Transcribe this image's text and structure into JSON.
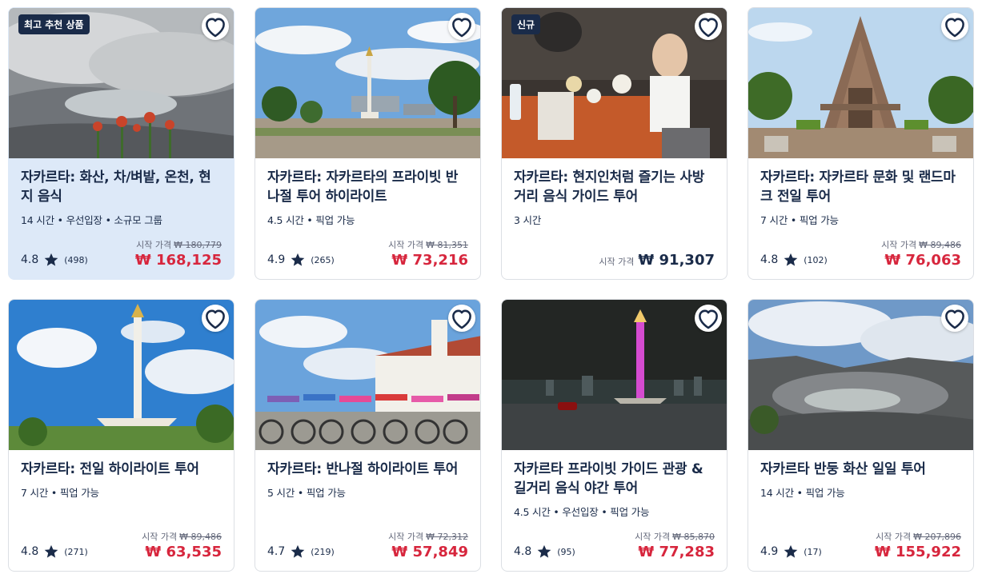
{
  "colors": {
    "accent_price": "#d7263d",
    "text": "#1a2b49",
    "featured_bg": "#dde9f8",
    "badge_bg": "#1a2b49"
  },
  "labels": {
    "price_from": "시작 가격"
  },
  "cards": [
    {
      "badge": "최고 추천 상품",
      "title": "자카르타: 화산, 차/벼밭, 온천, 현지 음식",
      "meta": "14 시간 • 우선입장 • 소규모 그룹",
      "rating": "4.8",
      "reviews": "(498)",
      "original_price": "₩ 180,779",
      "price": "₩ 168,125"
    },
    {
      "title": "자카르타: 자카르타의 프라이빗 반나절 투어 하이라이트",
      "meta": "4.5 시간 • 픽업 가능",
      "rating": "4.9",
      "reviews": "(265)",
      "original_price": "₩ 81,351",
      "price": "₩ 73,216"
    },
    {
      "badge": "신규",
      "title": "자카르타: 현지인처럼 즐기는 사방 거리 음식 가이드 투어",
      "meta": "3 시간",
      "price": "₩ 91,307"
    },
    {
      "title": "자카르타: 자카르타 문화 및 랜드마크 전일 투어",
      "meta": "7 시간 • 픽업 가능",
      "rating": "4.8",
      "reviews": "(102)",
      "original_price": "₩ 89,486",
      "price": "₩ 76,063"
    },
    {
      "title": "자카르타: 전일 하이라이트 투어",
      "meta": "7 시간 • 픽업 가능",
      "rating": "4.8",
      "reviews": "(271)",
      "original_price": "₩ 89,486",
      "price": "₩ 63,535"
    },
    {
      "title": "자카르타: 반나절 하이라이트 투어",
      "meta": "5 시간 • 픽업 가능",
      "rating": "4.7",
      "reviews": "(219)",
      "original_price": "₩ 72,312",
      "price": "₩ 57,849"
    },
    {
      "title": "자카르타 프라이빗 가이드 관광 & 길거리 음식 야간 투어",
      "meta": "4.5 시간 • 우선입장 • 픽업 가능",
      "rating": "4.8",
      "reviews": "(95)",
      "original_price": "₩ 85,870",
      "price": "₩ 77,283"
    },
    {
      "title": "자카르타 반둥 화산 일일 투어",
      "meta": "14 시간 • 픽업 가능",
      "rating": "4.9",
      "reviews": "(17)",
      "original_price": "₩ 207,896",
      "price": "₩ 155,922"
    }
  ]
}
